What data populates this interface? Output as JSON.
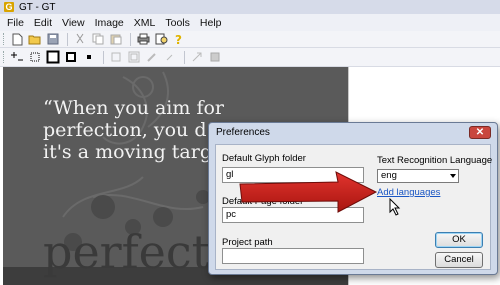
{
  "window": {
    "title": "GT - GT"
  },
  "menu": [
    "File",
    "Edit",
    "View",
    "Image",
    "XML",
    "Tools",
    "Help"
  ],
  "canvas": {
    "quote_lines": "“When you aim for\nperfection, you d\nit's a moving targ",
    "big_word": "perfectio"
  },
  "dialog": {
    "title": "Preferences",
    "close_label": "✕",
    "glyph_folder_label": "Default Glyph folder",
    "glyph_folder_value": "gl",
    "page_folder_label": "Default Page folder",
    "page_folder_value": "pc",
    "project_path_label": "Project path",
    "project_path_value": "",
    "language_label": "Text Recognition Language",
    "language_value": "eng",
    "add_languages_link": "Add languages",
    "ok_label": "OK",
    "cancel_label": "Cancel"
  },
  "colors": {
    "arrow_red": "#c9211e",
    "dialog_frame": "#cfd9ea",
    "link_blue": "#1a56c4"
  }
}
